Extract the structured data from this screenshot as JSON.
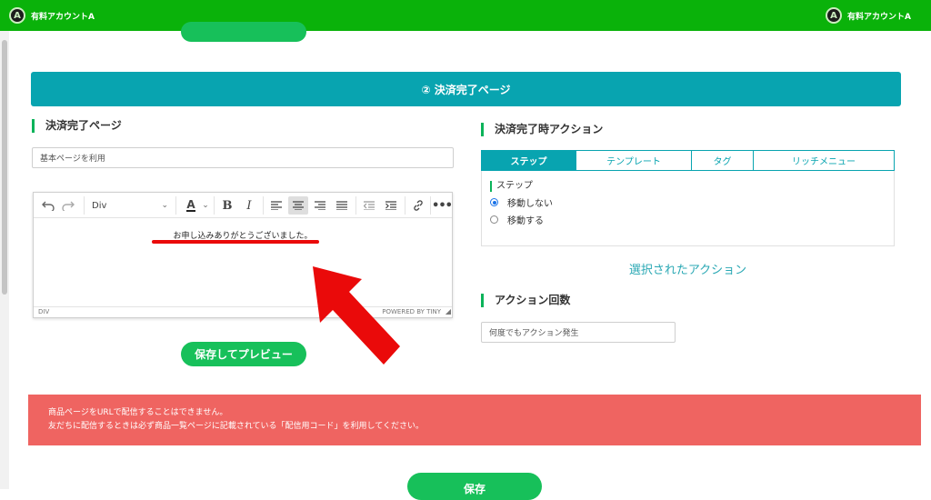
{
  "header": {
    "account_initial": "A",
    "account_name_left": "有料アカウントA",
    "account_name_right": "有料アカウントA"
  },
  "section_banner": "② 決済完了ページ",
  "left": {
    "title": "決済完了ページ",
    "page_select_value": "基本ページを利用",
    "editor": {
      "block_format": "Div",
      "content": "お申し込みありがとうございました。",
      "status_path": "DIV",
      "branding": "POWERED BY TINY"
    },
    "save_preview_label": "保存してプレビュー"
  },
  "right": {
    "title": "決済完了時アクション",
    "tabs": [
      {
        "label": "ステップ",
        "active": true
      },
      {
        "label": "テンプレート",
        "active": false
      },
      {
        "label": "タグ",
        "active": false
      },
      {
        "label": "リッチメニュー",
        "active": false
      }
    ],
    "panel_title": "ステップ",
    "radio_options": [
      {
        "label": "移動しない",
        "checked": true
      },
      {
        "label": "移動する",
        "checked": false
      }
    ],
    "selected_action_label": "選択されたアクション",
    "count_title": "アクション回数",
    "count_value": "何度でもアクション発生"
  },
  "alert": {
    "line1": "商品ページをURLで配信することはできません。",
    "line2": "友だちに配信するときは必ず商品一覧ページに記載されている「配信用コード」を利用してください。"
  },
  "save_label": "保存",
  "colors": {
    "header_green": "#0ab20a",
    "teal": "#08a4b0",
    "button_green": "#17c05a",
    "alert_red": "#ef6461",
    "annotation_red": "#ea0a0a"
  }
}
